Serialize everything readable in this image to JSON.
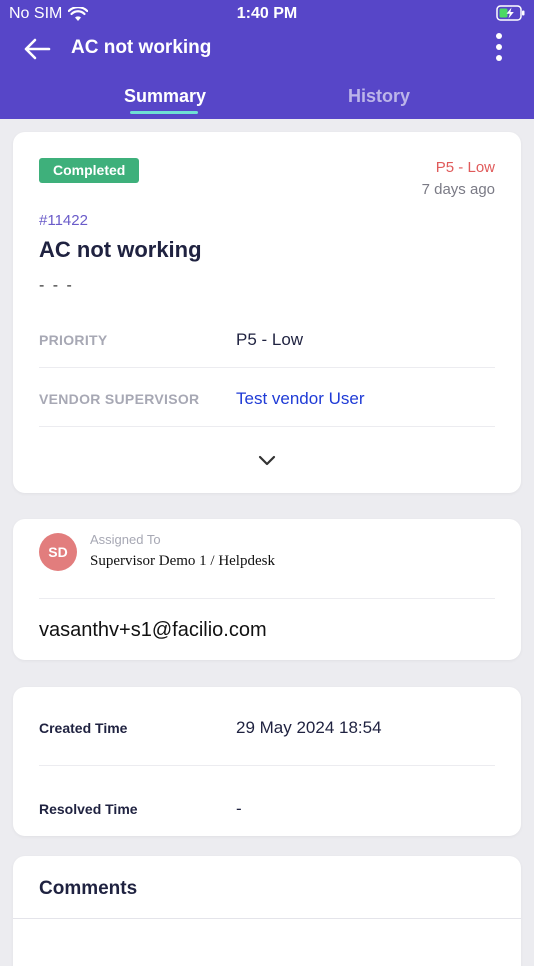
{
  "status_bar": {
    "carrier": "No SIM",
    "time": "1:40 PM"
  },
  "header": {
    "title": "AC not working",
    "tabs": [
      {
        "label": "Summary",
        "active": true
      },
      {
        "label": "History",
        "active": false
      }
    ],
    "icons": {
      "back": "arrow-left-icon",
      "more": "more-vertical-icon"
    },
    "colors": {
      "background": "#5746c8",
      "tab_indicator": "#6ee0d4"
    }
  },
  "summary": {
    "status": "Completed",
    "priority_badge": "P5 - Low",
    "age": "7 days ago",
    "id": "#11422",
    "subject": "AC not working",
    "description": "- - -",
    "fields": [
      {
        "label": "PRIORITY",
        "value": "P5 - Low"
      },
      {
        "label": "VENDOR SUPERVISOR",
        "value": "Test vendor User"
      }
    ],
    "colors": {
      "status": "#3eb07b",
      "priority": "#e05a5a",
      "link": "#1f3bd6"
    }
  },
  "assignment": {
    "avatar_initials": "SD",
    "label": "Assigned To",
    "value": "Supervisor Demo 1 / Helpdesk",
    "email": "vasanthv+s1@facilio.com"
  },
  "times": {
    "created_label": "Created Time",
    "created_value": "29 May 2024 18:54",
    "resolved_label": "Resolved Time",
    "resolved_value": "-"
  },
  "comments": {
    "title": "Comments"
  }
}
